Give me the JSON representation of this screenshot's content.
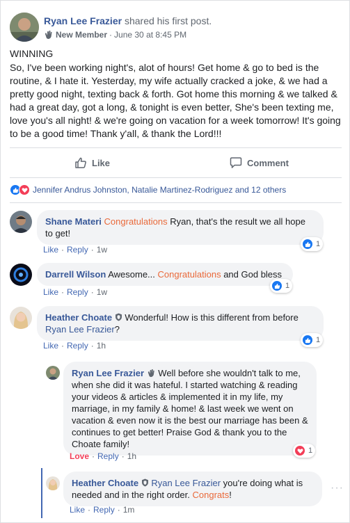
{
  "post": {
    "author": "Ryan Lee Frazier",
    "action": "shared his first post.",
    "badge": "New Member",
    "timestamp": "June 30 at 8:45 PM",
    "separator": "·",
    "title": "WINNING",
    "body": "So, I've been working night's, alot of hours! Get home & go to bed is the routine, & I hate it. Yesterday, my wife actually cracked a joke, & we had a pretty good night, texting back & forth. Got home this morning & we talked & had a great day, got a long, & tonight is even better, She's been texting me, love you's all night! & we're going on vacation for a week tomorrow! It's going to be a good time! Thank y'all, & thank the Lord!!!"
  },
  "actions": {
    "like_label": "Like",
    "comment_label": "Comment"
  },
  "reactions": {
    "summary": "Jennifer Andrus Johnston, Natalie Martinez-Rodriguez and 12 others"
  },
  "comments": [
    {
      "author": "Shane Materi",
      "keyword": "Congratulations",
      "text": "Ryan, that's the result we all hope to get!",
      "like": "Like",
      "reply": "Reply",
      "time": "1w",
      "count": "1",
      "reaction": "like",
      "sep": "·"
    },
    {
      "author": "Darrell Wilson",
      "pre": "Awesome...",
      "keyword": "Congratulations",
      "text": "and God bless",
      "like": "Like",
      "reply": "Reply",
      "time": "1w",
      "count": "1",
      "reaction": "like",
      "sep": "·"
    },
    {
      "author": "Heather Choate",
      "text": "Wonderful! How is this different from before",
      "tag": "Ryan Lee Frazier",
      "end": "?",
      "like": "Like",
      "reply": "Reply",
      "time": "1h",
      "count": "1",
      "reaction": "like",
      "sep": "·"
    }
  ],
  "replies": [
    {
      "author": "Ryan Lee Frazier",
      "text": "Well before she wouldn't talk to me, when she did it was hateful. I started watching & reading your videos & articles & implemented it in my life, my marriage, in my family & home! & last week we went on vacation & even now it is the best our marriage has been & continues to get better! Praise God & thank you to the Choate family!",
      "like": "Love",
      "reply": "Reply",
      "time": "1h",
      "count": "1",
      "reaction": "love",
      "sep": "·"
    },
    {
      "author": "Heather Choate",
      "tag": "Ryan Lee Frazier",
      "text": "you're doing what is needed and in the right order.",
      "keyword": "Congrats",
      "end": "!",
      "like": "Like",
      "reply": "Reply",
      "time": "1m",
      "sep": "·"
    }
  ],
  "colors": {
    "link": "#385898",
    "keyword": "#e9693a",
    "like_blue": "#1877f2",
    "love_red": "#f33e58"
  },
  "icons": [
    "new-member-wave-icon",
    "like-thumb-icon",
    "comment-bubble-icon",
    "like-reaction-icon",
    "love-reaction-icon",
    "admin-shield-icon",
    "more-options-icon"
  ]
}
